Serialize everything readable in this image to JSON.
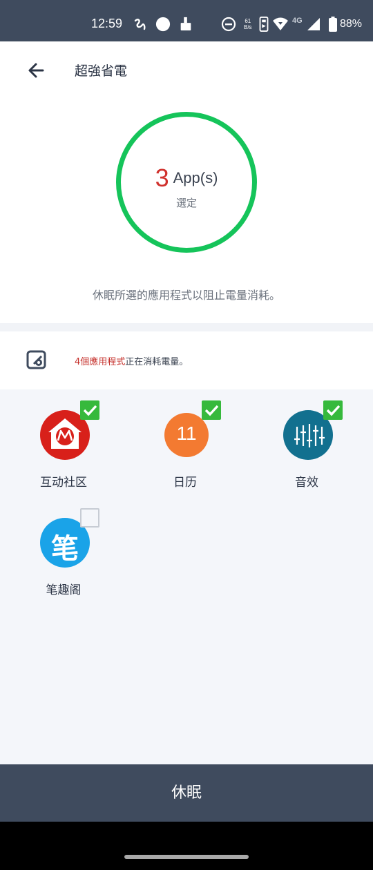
{
  "status_bar": {
    "time": "12:59",
    "net_speed_value": "61",
    "net_speed_unit": "B/s",
    "network_type": "4G",
    "battery_percent": "88%"
  },
  "header": {
    "title": "超強省電",
    "back_icon": "arrow-left-icon"
  },
  "summary": {
    "count": "3",
    "unit": "App(s)",
    "selected_label": "選定",
    "ring_color": "#15c45a",
    "count_color": "#d0312d"
  },
  "description": "休眠所選的應用程式以阻止電量消耗。",
  "info": {
    "highlight": "4個應用程式",
    "rest": "正在消耗電量。",
    "highlight_color": "#c5302b"
  },
  "apps": [
    {
      "name": "互动社区",
      "checked": true,
      "icon": "motorola-community-icon",
      "color": "#d8201a"
    },
    {
      "name": "日历",
      "checked": true,
      "icon": "calendar-icon",
      "color": "#f37a31",
      "icon_text": "11"
    },
    {
      "name": "音效",
      "checked": true,
      "icon": "equalizer-icon",
      "color": "#12708f"
    },
    {
      "name": "笔趣阁",
      "checked": false,
      "icon": "biquge-icon",
      "color": "#1aa3e8",
      "icon_text": "笔"
    }
  ],
  "action_button": {
    "label": "休眠",
    "color": "#3f4b5e"
  }
}
